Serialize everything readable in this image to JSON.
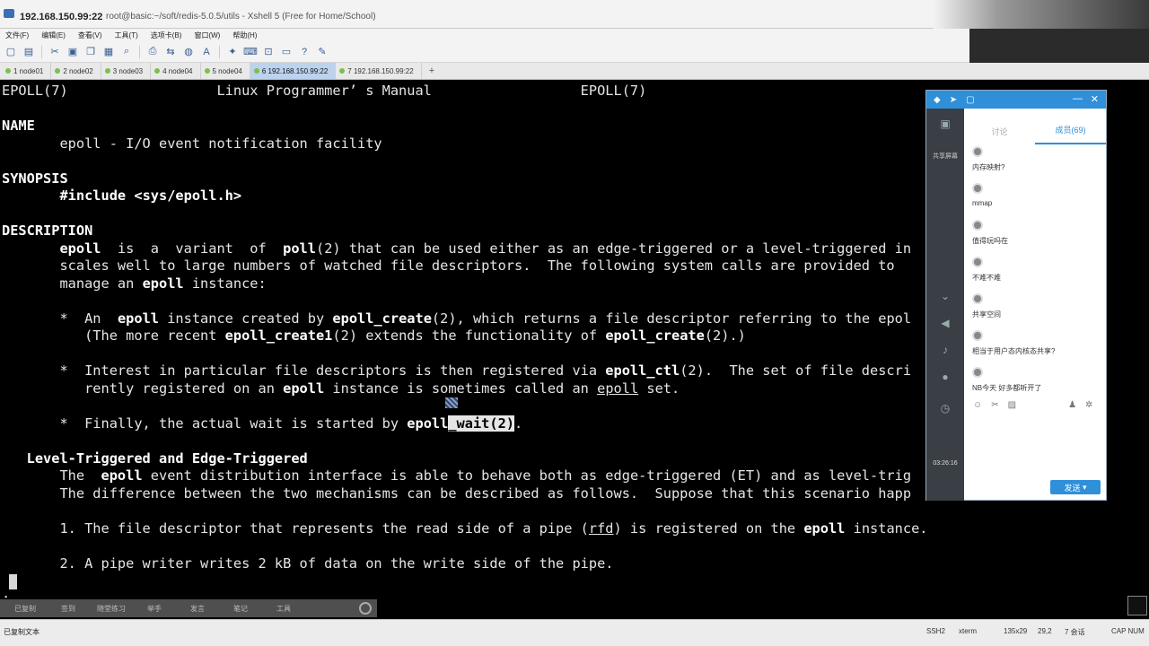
{
  "window": {
    "host": "192.168.150.99:22",
    "path": "root@basic:~/soft/redis-5.0.5/utils - Xshell 5 (Free for Home/School)"
  },
  "menu": [
    "文件(F)",
    "编辑(E)",
    "查看(V)",
    "工具(T)",
    "选项卡(B)",
    "窗口(W)",
    "帮助(H)"
  ],
  "toolbar_icons": [
    "new-icon",
    "open-icon",
    "disconnect-icon",
    "properties-icon",
    "copy-icon",
    "paste-icon",
    "find-icon",
    "print-icon",
    "transfer-icon",
    "globe-icon",
    "font-icon",
    "script-icon",
    "keyboard-icon",
    "lock-icon",
    "chat-icon",
    "help-icon",
    "compose-icon"
  ],
  "tabs": [
    {
      "label": "1 node01",
      "active": false
    },
    {
      "label": "2 node02",
      "active": false
    },
    {
      "label": "3 node03",
      "active": false
    },
    {
      "label": "4 node04",
      "active": false
    },
    {
      "label": "5 node04",
      "active": false
    },
    {
      "label": "6 192.168.150.99:22",
      "active": true
    },
    {
      "label": "7 192.168.150.99:22",
      "active": false
    }
  ],
  "terminal": {
    "lines": [
      [
        {
          "t": "EPOLL(7)                  Linux Programmer’ s Manual                  EPOLL(7)"
        }
      ],
      [],
      [
        {
          "t": "NAME",
          "b": true
        }
      ],
      [
        {
          "t": "       epoll - I/O event notification facility"
        }
      ],
      [],
      [
        {
          "t": "SYNOPSIS",
          "b": true
        }
      ],
      [
        {
          "t": "       "
        },
        {
          "t": "#include <sys/epoll.h>",
          "b": true
        }
      ],
      [],
      [
        {
          "t": "DESCRIPTION",
          "b": true
        }
      ],
      [
        {
          "t": "       "
        },
        {
          "t": "epoll",
          "b": true
        },
        {
          "t": "  is  a  variant  of  "
        },
        {
          "t": "poll",
          "b": true
        },
        {
          "t": "(2) that can be used either as an edge-triggered or a level-triggered in"
        }
      ],
      [
        {
          "t": "       scales well to large numbers of watched file descriptors.  The following system calls are provided to"
        }
      ],
      [
        {
          "t": "       manage an "
        },
        {
          "t": "epoll",
          "b": true
        },
        {
          "t": " instance:"
        }
      ],
      [],
      [
        {
          "t": "       *  An  "
        },
        {
          "t": "epoll",
          "b": true
        },
        {
          "t": " instance created by "
        },
        {
          "t": "epoll_create",
          "b": true
        },
        {
          "t": "(2), which returns a file descriptor referring to the epol"
        }
      ],
      [
        {
          "t": "          (The more recent "
        },
        {
          "t": "epoll_create1",
          "b": true
        },
        {
          "t": "(2) extends the functionality of "
        },
        {
          "t": "epoll_create",
          "b": true
        },
        {
          "t": "(2).)"
        }
      ],
      [],
      [
        {
          "t": "       *  Interest in particular file descriptors is then registered via "
        },
        {
          "t": "epoll_ctl",
          "b": true
        },
        {
          "t": "(2).  The set of file descri"
        }
      ],
      [
        {
          "t": "          rently registered on an "
        },
        {
          "t": "epoll",
          "b": true
        },
        {
          "t": " instance is sometimes called an "
        },
        {
          "t": "epoll",
          "u": true
        },
        {
          "t": " set."
        }
      ],
      [],
      [
        {
          "t": "       *  Finally, the actual wait is started by "
        },
        {
          "t": "epoll",
          "b": true
        },
        {
          "t": "_wait(2)",
          "hl": true
        },
        {
          "t": "."
        }
      ],
      [],
      [
        {
          "t": "   Level-Triggered and Edge-Triggered",
          "b": true
        }
      ],
      [
        {
          "t": "       The  "
        },
        {
          "t": "epoll",
          "b": true
        },
        {
          "t": " event distribution interface is able to behave both as edge-triggered (ET) and as level-trig"
        }
      ],
      [
        {
          "t": "       The difference between the two mechanisms can be described as follows.  Suppose that this scenario happ"
        }
      ],
      [],
      [
        {
          "t": "       1. The file descriptor that represents the read side of a pipe ("
        },
        {
          "t": "rfd",
          "u": true
        },
        {
          "t": ") is registered on the "
        },
        {
          "t": "epoll",
          "b": true
        },
        {
          "t": " instance."
        }
      ],
      [],
      [
        {
          "t": "       2. A pipe writer writes 2 kB of data on the write side of the pipe."
        }
      ],
      [],
      [
        {
          "t": ":"
        }
      ]
    ]
  },
  "shortcuts": [
    "已复制",
    "签到",
    "随堂练习",
    "举手",
    "发言",
    "笔记",
    "工具"
  ],
  "status": {
    "left": "已复制文本",
    "items": [
      "SSH2",
      "xterm",
      "135x29",
      "29,2",
      "7 会话",
      "CAP NUM"
    ]
  },
  "chat": {
    "screen_label": "共享屏幕",
    "time": "03:26:16",
    "tab_discussion": "讨论",
    "tab_members": "成员(69)",
    "messages": [
      {
        "nick": "",
        "text": "内存映射?"
      },
      {
        "nick": "",
        "text": "mmap"
      },
      {
        "nick": "",
        "text": "值得玩吗在"
      },
      {
        "nick": "",
        "text": "不难不难"
      },
      {
        "nick": "",
        "text": "共享空间"
      },
      {
        "nick": "",
        "text": "相当于用户态内核态共享?"
      },
      {
        "nick": "",
        "text": "NB今天 好多都听开了"
      }
    ],
    "send_label": "发送"
  }
}
